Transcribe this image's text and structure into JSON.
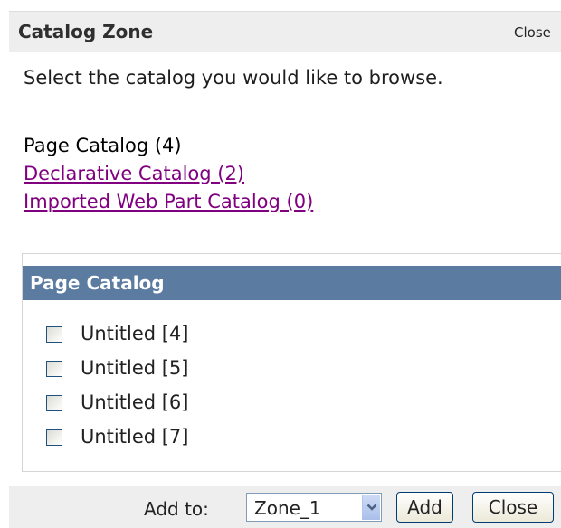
{
  "zone": {
    "title": "Catalog Zone",
    "close_label": "Close",
    "instruction": "Select the catalog you would like to browse."
  },
  "catalogs": [
    {
      "label": "Page Catalog (4)",
      "selected": true
    },
    {
      "label": "Declarative Catalog (2)",
      "selected": false
    },
    {
      "label": "Imported Web Part Catalog (0)",
      "selected": false
    }
  ],
  "part_panel": {
    "title": "Page Catalog",
    "items": [
      {
        "label": "Untitled [4]",
        "checked": false
      },
      {
        "label": "Untitled [5]",
        "checked": false
      },
      {
        "label": "Untitled [6]",
        "checked": false
      },
      {
        "label": "Untitled [7]",
        "checked": false
      }
    ]
  },
  "footer": {
    "add_to_label": "Add to:",
    "zone_select_value": "Zone_1",
    "add_button": "Add",
    "close_button": "Close"
  },
  "colors": {
    "header_background": "#eeeeee",
    "part_title_background": "#5b7ba0",
    "link": "#800080"
  }
}
